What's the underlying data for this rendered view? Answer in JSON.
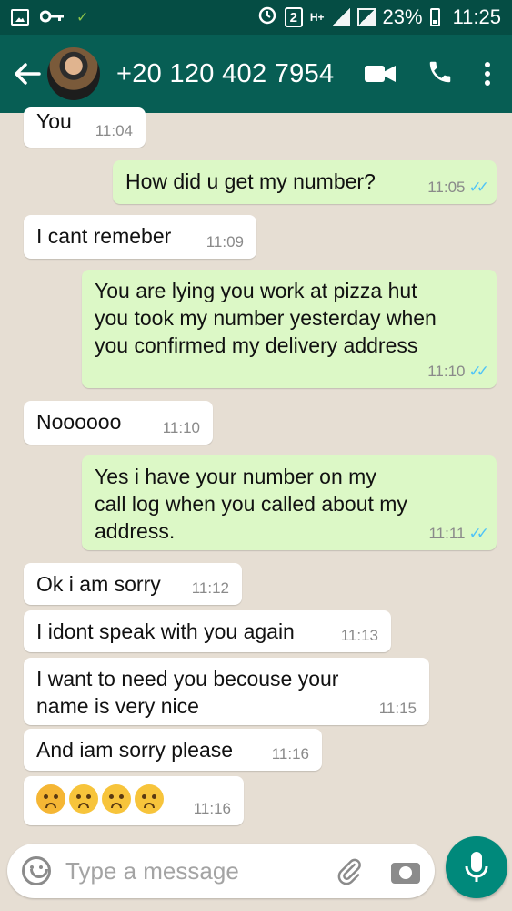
{
  "status_bar": {
    "badge": "2",
    "network": "H+",
    "battery": "23%",
    "time": "11:25"
  },
  "header": {
    "contact": "+20 120 402 7954"
  },
  "messages": [
    {
      "dir": "in",
      "text": "You",
      "time": "11:04"
    },
    {
      "dir": "out",
      "text": "How did u get my number?",
      "time": "11:05"
    },
    {
      "dir": "in",
      "text": "I cant remeber",
      "time": "11:09"
    },
    {
      "dir": "out",
      "text": "You are lying you work at pizza hut\nyou took my number yesterday when\nyou confirmed my delivery address",
      "time": "11:10"
    },
    {
      "dir": "in",
      "text": "Noooooo",
      "time": "11:10"
    },
    {
      "dir": "out",
      "text": "Yes i have your number on my\ncall log when you called about my\naddress.",
      "time": "11:11"
    },
    {
      "dir": "in",
      "text": "Ok i am sorry",
      "time": "11:12"
    },
    {
      "dir": "in",
      "text": "I idont speak with you again",
      "time": "11:13"
    },
    {
      "dir": "in",
      "text": "I want to need you  becouse your\nname is very nice",
      "time": "11:15"
    },
    {
      "dir": "in",
      "text": "And iam sorry please",
      "time": "11:16"
    },
    {
      "dir": "in",
      "text": "",
      "emojis": [
        "crying-face",
        "sad-face",
        "sad-sweat-face",
        "sad-face"
      ],
      "time": "11:16"
    }
  ],
  "input": {
    "placeholder": "Type a message"
  },
  "colors": {
    "header": "#075e54",
    "status_bar": "#054d44",
    "incoming": "#ffffff",
    "outgoing": "#dcf8c6",
    "read_ticks": "#4fc3f7",
    "fab": "#00897b"
  }
}
